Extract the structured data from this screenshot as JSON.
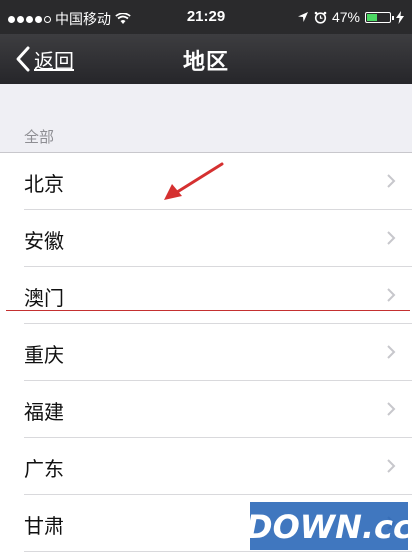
{
  "status_bar": {
    "carrier": "中国移动",
    "time": "21:29",
    "battery_text": "47%",
    "battery_level": 0.47,
    "icons": [
      "signal-dots-icon",
      "wifi-icon",
      "location-arrow-icon",
      "alarm-icon",
      "battery-icon",
      "charging-bolt-icon"
    ]
  },
  "nav": {
    "back_label": "返回",
    "title": "地区"
  },
  "section": {
    "header": "全部"
  },
  "regions": [
    {
      "name": "北京"
    },
    {
      "name": "安徽"
    },
    {
      "name": "澳门"
    },
    {
      "name": "重庆"
    },
    {
      "name": "福建"
    },
    {
      "name": "广东"
    },
    {
      "name": "甘肃"
    }
  ],
  "watermark": {
    "text": "DOWN.cc"
  },
  "colors": {
    "nav_bg": "#2a2a2c",
    "list_bg": "#ffffff",
    "page_bg": "#efeff4",
    "annotation_red": "#d53030",
    "battery_green": "#4cd964"
  }
}
